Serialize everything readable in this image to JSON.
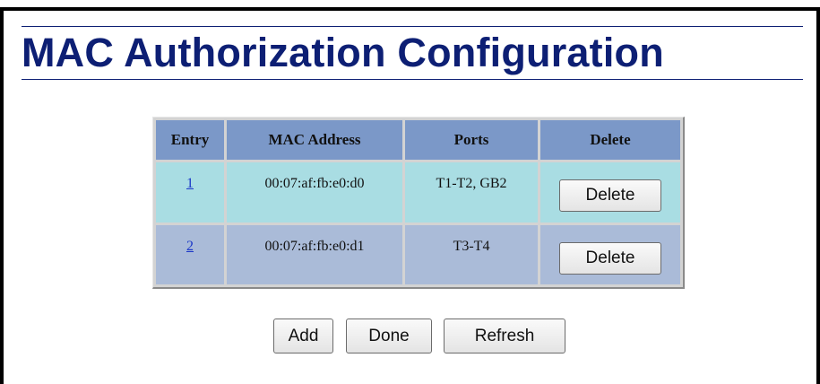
{
  "page": {
    "title": "MAC Authorization Configuration"
  },
  "table": {
    "headers": [
      "Entry",
      "MAC Address",
      "Ports",
      "Delete"
    ],
    "rows": [
      {
        "entry": "1",
        "mac": "00:07:af:fb:e0:d0",
        "ports": "T1-T2, GB2",
        "delete_label": "Delete"
      },
      {
        "entry": "2",
        "mac": "00:07:af:fb:e0:d1",
        "ports": "T3-T4",
        "delete_label": "Delete"
      }
    ]
  },
  "actions": {
    "add_label": "Add",
    "done_label": "Done",
    "refresh_label": "Refresh"
  },
  "colors": {
    "title": "#0d1f74",
    "header_bg": "#7b98c8",
    "row1_bg": "#a9dde3",
    "row2_bg": "#aabbd8",
    "link": "#1a36c8"
  }
}
